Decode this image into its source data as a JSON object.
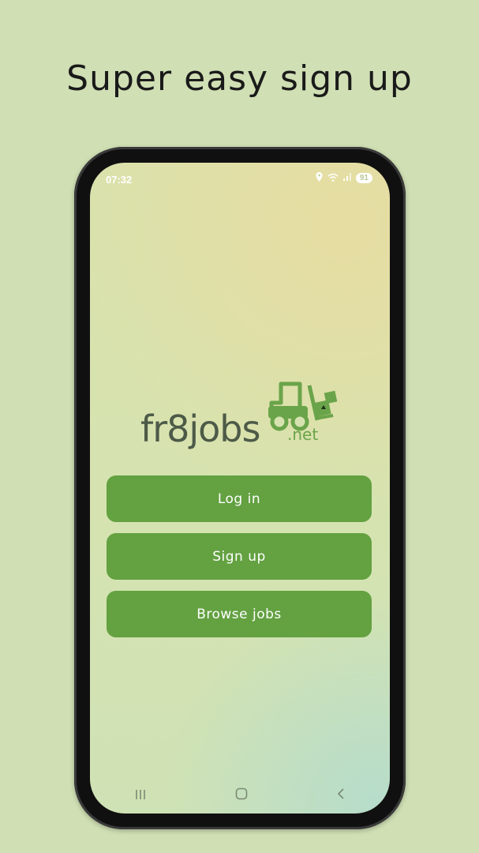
{
  "headline": "Super easy sign up",
  "status_bar": {
    "time": "07:32",
    "battery": "91"
  },
  "logo": {
    "main": "fr8jobs",
    "suffix": ".net"
  },
  "buttons": {
    "login": "Log in",
    "signup": "Sign up",
    "browse": "Browse jobs"
  },
  "nav": {
    "recent": "|||",
    "home": "○",
    "back": "‹"
  },
  "colors": {
    "background": "#d0dfb4",
    "button": "#63a141",
    "logo_green": "#6aa44a"
  }
}
